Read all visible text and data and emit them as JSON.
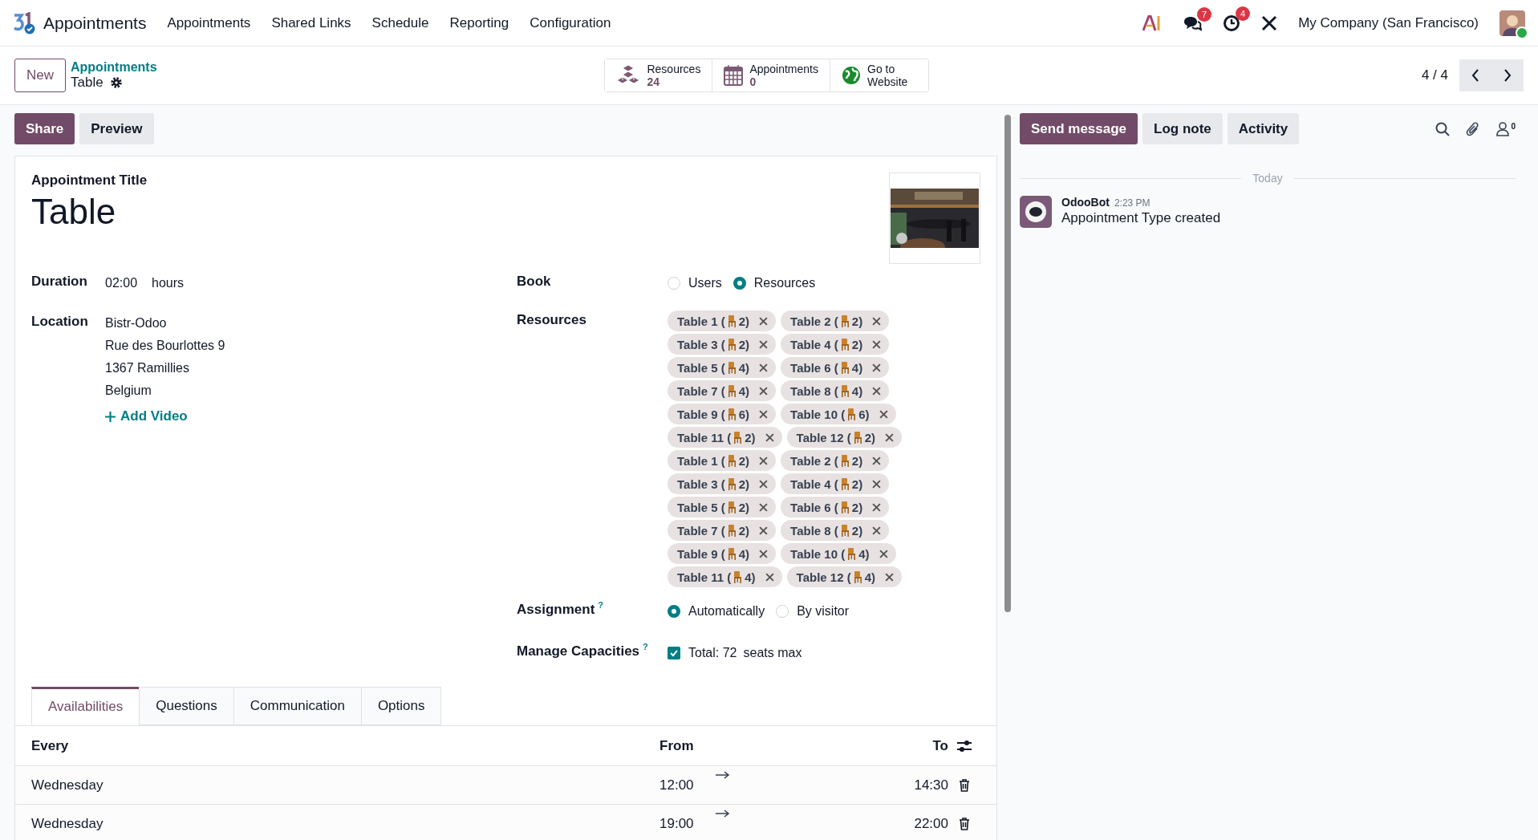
{
  "app": {
    "name": "Appointments"
  },
  "menu": [
    "Appointments",
    "Shared Links",
    "Schedule",
    "Reporting",
    "Configuration"
  ],
  "systray": {
    "messages_count": "7",
    "activities_count": "4",
    "company": "My Company (San Francisco)"
  },
  "control_panel": {
    "new_button": "New",
    "breadcrumb": "Appointments",
    "record": "Table",
    "pager": "4 / 4",
    "smart_buttons": [
      {
        "kind": "resources",
        "label": "Resources",
        "value": "24"
      },
      {
        "kind": "appointments",
        "label": "Appointments",
        "value": "0"
      },
      {
        "kind": "website",
        "label": "Go to Website"
      }
    ]
  },
  "actions": [
    {
      "label": "Share",
      "kind": "primary"
    },
    {
      "label": "Preview",
      "kind": "secondary"
    }
  ],
  "form": {
    "title_label": "Appointment Title",
    "title": "Table",
    "duration": {
      "label": "Duration",
      "value": "02:00",
      "unit": "hours"
    },
    "location": {
      "label": "Location",
      "lines": [
        "Bistr-Odoo",
        "Rue des Bourlottes 9",
        "1367 Ramillies",
        "Belgium"
      ]
    },
    "add_video": "Add Video",
    "book": {
      "label": "Book",
      "options": [
        {
          "label": "Users",
          "selected": false
        },
        {
          "label": "Resources",
          "selected": true
        }
      ]
    },
    "resources": {
      "label": "Resources",
      "tags": [
        {
          "before": "Table 1 (",
          "after": "2)"
        },
        {
          "before": "Table 2 (",
          "after": "2)"
        },
        {
          "before": "Table 3 (",
          "after": "2)"
        },
        {
          "before": "Table 4 (",
          "after": "2)"
        },
        {
          "before": "Table 5 (",
          "after": "4)"
        },
        {
          "before": "Table 6 (",
          "after": "4)"
        },
        {
          "before": "Table 7 (",
          "after": "4)"
        },
        {
          "before": "Table 8 (",
          "after": "4)"
        },
        {
          "before": "Table 9 (",
          "after": "6)"
        },
        {
          "before": "Table 10 (",
          "after": "6)"
        },
        {
          "before": "Table 11 (",
          "after": "2)"
        },
        {
          "before": "Table 12 (",
          "after": "2)"
        },
        {
          "before": "Table 1 (",
          "after": "2)"
        },
        {
          "before": "Table 2 (",
          "after": "2)"
        },
        {
          "before": "Table 3 (",
          "after": "2)"
        },
        {
          "before": "Table 4 (",
          "after": "2)"
        },
        {
          "before": "Table 5 (",
          "after": "2)"
        },
        {
          "before": "Table 6 (",
          "after": "2)"
        },
        {
          "before": "Table 7 (",
          "after": "2)"
        },
        {
          "before": "Table 8 (",
          "after": "2)"
        },
        {
          "before": "Table 9 (",
          "after": "4)"
        },
        {
          "before": "Table 10 (",
          "after": "4)"
        },
        {
          "before": "Table 11 (",
          "after": "4)"
        },
        {
          "before": "Table 12 (",
          "after": "4)"
        }
      ]
    },
    "assignment": {
      "label": "Assignment",
      "help": "?",
      "options": [
        {
          "label": "Automatically",
          "selected": true
        },
        {
          "label": "By visitor",
          "selected": false
        }
      ]
    },
    "capacities": {
      "label": "Manage Capacities",
      "help": "?",
      "checked": true,
      "total": "Total: 72",
      "unit": "seats max"
    }
  },
  "tabs": [
    {
      "label": "Availabilities",
      "selected": true
    },
    {
      "label": "Questions",
      "selected": false
    },
    {
      "label": "Communication",
      "selected": false
    },
    {
      "label": "Options",
      "selected": false
    }
  ],
  "table": {
    "columns": [
      "Every",
      "From",
      "To"
    ],
    "rows": [
      {
        "day": "Wednesday",
        "from": "12:00",
        "to": "14:30"
      },
      {
        "day": "Wednesday",
        "from": "19:00",
        "to": "22:00"
      }
    ]
  },
  "chatter": {
    "buttons": [
      {
        "label": "Send message",
        "kind": "primary"
      },
      {
        "label": "Log note",
        "kind": "secondary"
      },
      {
        "label": "Activity",
        "kind": "secondary"
      }
    ],
    "followers": "0",
    "date_separator": "Today",
    "messages": [
      {
        "author": "OdooBot",
        "time": "2:23 PM",
        "body": "Appointment Type created"
      }
    ]
  }
}
